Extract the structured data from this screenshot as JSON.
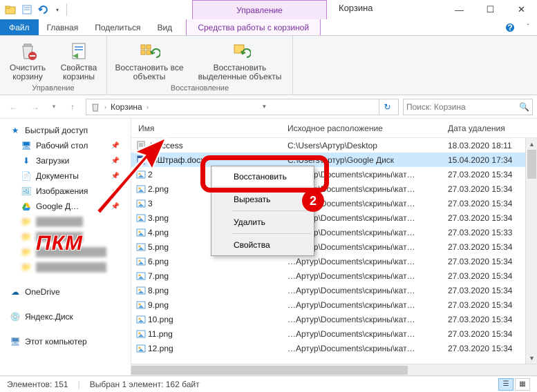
{
  "window": {
    "title": "Корзина",
    "management": "Управление"
  },
  "qat": {
    "redo_tooltip": "Redo"
  },
  "tabs": {
    "file": "Файл",
    "home": "Главная",
    "share": "Поделиться",
    "view": "Вид",
    "tools": "Средства работы с корзиной"
  },
  "ribbon": {
    "group1_label": "Управление",
    "group2_label": "Восстановление",
    "empty": "Очистить корзину",
    "props": "Свойства корзины",
    "restore_all": "Восстановить все объекты",
    "restore_sel": "Восстановить выделенные объекты"
  },
  "address": {
    "root": "Корзина",
    "search_placeholder": "Поиск: Корзина"
  },
  "nav": {
    "quick": "Быстрый доступ",
    "desktop": "Рабочий стол",
    "downloads": "Загрузки",
    "documents": "Документы",
    "pictures": "Изображения",
    "google": "Google Д…",
    "onedrive": "OneDrive",
    "yandex": "Яндекс.Диск",
    "thispc": "Этот компьютер"
  },
  "columns": {
    "name": "Имя",
    "loc": "Исходное расположение",
    "date": "Дата удаления"
  },
  "rows": [
    {
      "name": ".htaccess",
      "loc": "C:\\Users\\Артур\\Desktop",
      "date": "18.03.2020 18:11",
      "icon": "txt"
    },
    {
      "name": "~$Штраф.docx",
      "loc": "C:\\Users\\Артур\\Google Диск",
      "date": "15.04.2020 17:34",
      "icon": "doc",
      "selected": true
    },
    {
      "name": "2",
      "loc": "…Артур\\Documents\\скрины\\кат…",
      "date": "27.03.2020 15:34",
      "icon": "img"
    },
    {
      "name": "2.png",
      "loc": "…Артур\\Documents\\скрины\\кат…",
      "date": "27.03.2020 15:34",
      "icon": "img"
    },
    {
      "name": "3",
      "loc": "…Артур\\Documents\\скрины\\кат…",
      "date": "27.03.2020 15:34",
      "icon": "img"
    },
    {
      "name": "3.png",
      "loc": "…Артур\\Documents\\скрины\\кат…",
      "date": "27.03.2020 15:34",
      "icon": "img"
    },
    {
      "name": "4.png",
      "loc": "…Артур\\Documents\\скрины\\кат…",
      "date": "27.03.2020 15:33",
      "icon": "img"
    },
    {
      "name": "5.png",
      "loc": "…Артур\\Documents\\скрины\\кат…",
      "date": "27.03.2020 15:34",
      "icon": "img"
    },
    {
      "name": "6.png",
      "loc": "…Артур\\Documents\\скрины\\кат…",
      "date": "27.03.2020 15:34",
      "icon": "img"
    },
    {
      "name": "7.png",
      "loc": "…Артур\\Documents\\скрины\\кат…",
      "date": "27.03.2020 15:34",
      "icon": "img"
    },
    {
      "name": "8.png",
      "loc": "…Артур\\Documents\\скрины\\кат…",
      "date": "27.03.2020 15:34",
      "icon": "img"
    },
    {
      "name": "9.png",
      "loc": "…Артур\\Documents\\скрины\\кат…",
      "date": "27.03.2020 15:34",
      "icon": "img"
    },
    {
      "name": "10.png",
      "loc": "…Артур\\Documents\\скрины\\кат…",
      "date": "27.03.2020 15:34",
      "icon": "img"
    },
    {
      "name": "11.png",
      "loc": "…Артур\\Documents\\скрины\\кат…",
      "date": "27.03.2020 15:34",
      "icon": "img"
    },
    {
      "name": "12.png",
      "loc": "…Артур\\Documents\\скрины\\кат…",
      "date": "27.03.2020 15:34",
      "icon": "img"
    }
  ],
  "ctx": {
    "restore": "Восстановить",
    "cut": "Вырезать",
    "delete": "Удалить",
    "props": "Свойства"
  },
  "status": {
    "count": "Элементов: 151",
    "sel": "Выбран 1 элемент: 162 байт"
  },
  "overlay": {
    "pkm": "ПКМ",
    "step": "2"
  }
}
